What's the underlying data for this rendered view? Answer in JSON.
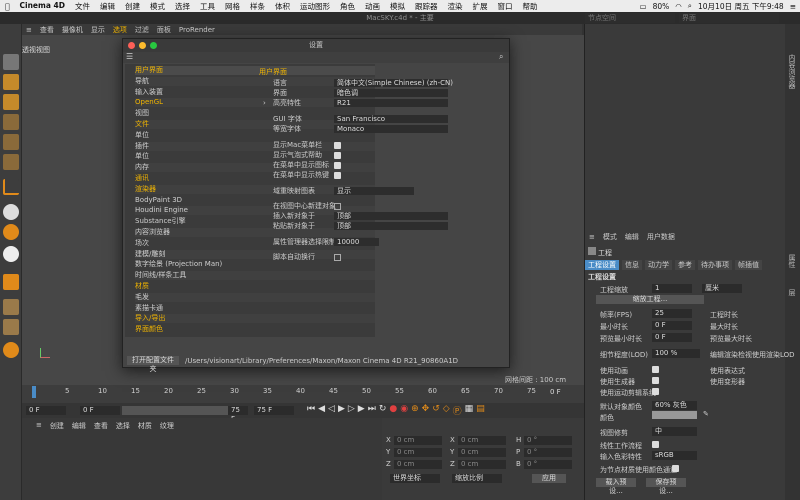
{
  "macmenu": {
    "items": [
      "Cinema 4D",
      "文件",
      "编辑",
      "创建",
      "模式",
      "选择",
      "工具",
      "网格",
      "样条",
      "体积",
      "运动图形",
      "角色",
      "动画",
      "模拟",
      "跟踪器",
      "渲染",
      "扩展",
      "窗口",
      "帮助"
    ],
    "battery": "80%",
    "datetime": "10月10日 周五 下午9:48"
  },
  "app": {
    "title": "MacSKY.c4d * - 主要",
    "menu": [
      "查看",
      "摄像机",
      "显示",
      "选项",
      "过滤",
      "面板",
      "ProRender"
    ],
    "active_menu_index": 3,
    "viewport_label": "透视视图",
    "grid_label": "网格间距 : 100 cm",
    "top_right": {
      "node_space": "节点空间",
      "interface": "界面"
    }
  },
  "sidebar_tabs": [
    "内容浏览器",
    "属性",
    "层"
  ],
  "dialog": {
    "title": "设置",
    "tree": [
      {
        "label": "用户界面",
        "hl": true
      },
      {
        "label": "导航"
      },
      {
        "label": "输入装置"
      },
      {
        "label": "OpenGL",
        "hl": true
      },
      {
        "label": "视图"
      },
      {
        "label": "文件",
        "hl": true
      },
      {
        "label": "单位"
      },
      {
        "label": "插件"
      },
      {
        "label": "单位"
      },
      {
        "label": "内存"
      },
      {
        "label": "通讯",
        "hl": true
      },
      {
        "label": "渲染器",
        "hl": true
      },
      {
        "label": "BodyPaint 3D"
      },
      {
        "label": "Houdini Engine"
      },
      {
        "label": "Substance引擎"
      },
      {
        "label": "内容浏览器"
      },
      {
        "label": "场次"
      },
      {
        "label": "建模/雕刻"
      },
      {
        "label": "数字绘景 (Projection Man)"
      },
      {
        "label": "时间线/样条工具"
      },
      {
        "label": "材质",
        "hl": true
      },
      {
        "label": "毛发"
      },
      {
        "label": "素描卡通"
      },
      {
        "label": "导入/导出",
        "hl": true
      },
      {
        "label": "界面颜色",
        "hl": true
      }
    ],
    "section_title": "用户界面",
    "settings": {
      "language": {
        "label": "语言",
        "value": "简体中文(Simple Chinese) (zh-CN)"
      },
      "scheme": {
        "label": "界面",
        "value": "暗色调"
      },
      "highlight": {
        "label": "高亮特性",
        "value": "R21"
      },
      "gui_font": {
        "label": "GUI 字体",
        "value": "San Francisco"
      },
      "mono_font": {
        "label": "等宽字体",
        "value": "Monaco"
      },
      "checks": [
        "显示Mac菜单栏",
        "显示气泡式帮助",
        "在菜单中显示图标",
        "在菜单中显示热键"
      ],
      "field_map": {
        "label": "域重映射图表",
        "value": "显示"
      },
      "new_obj": {
        "label": "在视图中心新建对象"
      },
      "insert_new": {
        "label": "插入新对象于",
        "value": "顶部"
      },
      "paste_new": {
        "label": "粘贴新对象于",
        "value": "顶部"
      },
      "attr_limit": {
        "label": "属性管理器选择限制",
        "value": "10000"
      },
      "script_wrap": {
        "label": "脚本自动换行"
      }
    },
    "open_config_button": "打开配置文件夹",
    "config_path": "/Users/visionart/Library/Preferences/Maxon/Maxon Cinema 4D R21_90860A1D"
  },
  "attributes": {
    "menu": [
      "模式",
      "编辑",
      "用户数据"
    ],
    "header": "工程",
    "tabs": [
      "工程设置",
      "信息",
      "动力学",
      "参考",
      "待办事项",
      "帧插值"
    ],
    "section": "工程设置",
    "project_scale": {
      "label": "工程缩放",
      "value": "1",
      "unit": "厘米"
    },
    "scale_button": "缩放工程...",
    "fps": {
      "label": "帧率(FPS)",
      "value": "25"
    },
    "project_time": {
      "label": "工程时长"
    },
    "min_time": {
      "label": "最小时长",
      "value": "0 F"
    },
    "max_time": {
      "label": "最大时长"
    },
    "preview_min": {
      "label": "预览最小时长",
      "value": "0 F"
    },
    "preview_max": {
      "label": "预览最大时长"
    },
    "lod": {
      "label": "细节程度(LOD)",
      "value": "100 %"
    },
    "render_lod": {
      "label": "编辑渲染检视使用渲染LOD"
    },
    "use_anim": {
      "label": "使用动画"
    },
    "use_expr": {
      "label": "使用表达式"
    },
    "use_gen": {
      "label": "使用生成器"
    },
    "use_deform": {
      "label": "使用变形器"
    },
    "use_motion": {
      "label": "使用运动剪辑系统"
    },
    "default_color": {
      "label": "默认对象颜色",
      "value": "60% 灰色"
    },
    "color": {
      "label": "颜色"
    },
    "view_correction": {
      "label": "视图修剪",
      "value": "中"
    },
    "linear": {
      "label": "线性工作流程"
    },
    "input_color": {
      "label": "输入色彩特性",
      "value": "sRGB"
    },
    "node_mat": {
      "label": "为节点材质使用颜色通道"
    },
    "load_preset": "载入预设...",
    "save_preset": "保存预设..."
  },
  "timeline": {
    "ticks": [
      "0",
      "5",
      "10",
      "15",
      "20",
      "25",
      "30",
      "35",
      "40",
      "45",
      "50",
      "55",
      "60",
      "65",
      "70",
      "75"
    ],
    "end_marker": "0 F",
    "fields": [
      "0 F",
      "0 F",
      "75 F",
      "75 F"
    ]
  },
  "bottom": {
    "menu": [
      "创建",
      "编辑",
      "查看",
      "选择",
      "材质",
      "纹理"
    ],
    "coords": [
      {
        "axis": "X",
        "pos": "0 cm",
        "mid_axis": "X",
        "size": "0 cm",
        "rot_axis": "H",
        "rot": "0 °"
      },
      {
        "axis": "Y",
        "pos": "0 cm",
        "mid_axis": "Y",
        "size": "0 cm",
        "rot_axis": "P",
        "rot": "0 °"
      },
      {
        "axis": "Z",
        "pos": "0 cm",
        "mid_axis": "Z",
        "size": "0 cm",
        "rot_axis": "B",
        "rot": "0 °"
      }
    ],
    "world": "世界坐标",
    "scale": "缩放比例",
    "apply": "应用"
  },
  "colors": {
    "accent": "#f0b400",
    "select": "#4a8cc7",
    "panel": "#3a3a3a"
  }
}
